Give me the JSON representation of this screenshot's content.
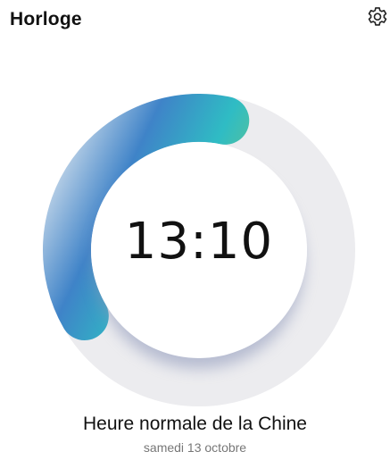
{
  "app": {
    "title": "Horloge"
  },
  "toolbar": {
    "settings_icon": "gear-icon"
  },
  "clock": {
    "time": "13:10",
    "progress": 0.365,
    "colors": {
      "track": "#ececef",
      "gradient_start": "#d7e3ee",
      "gradient_mid": "#3f83c8",
      "gradient_mid2": "#2fbcc4",
      "gradient_end": "#5ec392"
    }
  },
  "location": {
    "zone_name": "Heure normale de la Chine",
    "date": "samedi 13 octobre"
  }
}
